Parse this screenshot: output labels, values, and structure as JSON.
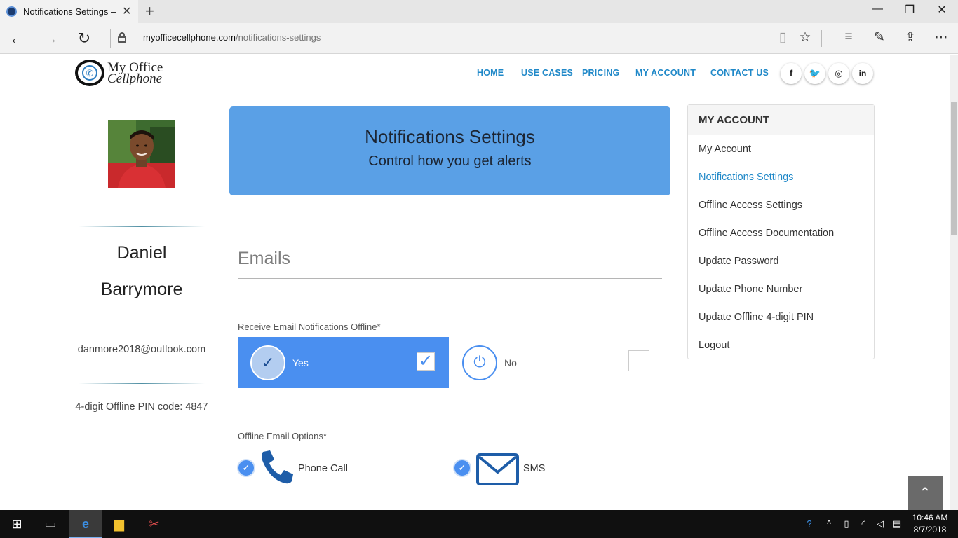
{
  "browser": {
    "tab_title": "Notifications Settings – I",
    "url_domain": "myofficecellphone.com",
    "url_path": "/notifications-settings",
    "window_controls": {
      "minimize": "—",
      "restore": "❐",
      "close": "✕"
    }
  },
  "site": {
    "logo_line1": "My Office",
    "logo_line2": "Cellphone",
    "nav": [
      "HOME",
      "USE CASES",
      "PRICING",
      "MY ACCOUNT",
      "CONTACT US"
    ],
    "social": [
      "f",
      "t",
      "ig",
      "in"
    ]
  },
  "profile": {
    "first_name": "Daniel",
    "last_name": "Barrymore",
    "email": "danmore2018@outlook.com",
    "pin_text": "4-digit Offline PIN code: 4847"
  },
  "banner": {
    "title": "Notifications Settings",
    "subtitle": "Control how you get alerts"
  },
  "emails": {
    "section_title": "Emails",
    "receive_label": "Receive Email Notifications Offline*",
    "yes_label": "Yes",
    "no_label": "No",
    "yes_selected": true,
    "options_label": "Offline Email Options*",
    "phone_call_label": "Phone Call",
    "sms_label": "SMS",
    "phone_call_checked": true,
    "sms_checked": true
  },
  "sidebar": {
    "heading": "MY ACCOUNT",
    "items": [
      {
        "label": "My Account",
        "active": false
      },
      {
        "label": "Notifications Settings",
        "active": true
      },
      {
        "label": "Offline Access Settings",
        "active": false
      },
      {
        "label": "Offline Access Documentation",
        "active": false
      },
      {
        "label": "Update Password",
        "active": false
      },
      {
        "label": "Update Phone Number",
        "active": false
      },
      {
        "label": "Update Offline 4-digit PIN",
        "active": false
      },
      {
        "label": "Logout",
        "active": false
      }
    ]
  },
  "taskbar": {
    "time": "10:46 AM",
    "date": "8/7/2018"
  },
  "colors": {
    "accent_blue": "#4a8ff0",
    "banner_blue": "#5aa0e6",
    "nav_link": "#1f88c8"
  }
}
